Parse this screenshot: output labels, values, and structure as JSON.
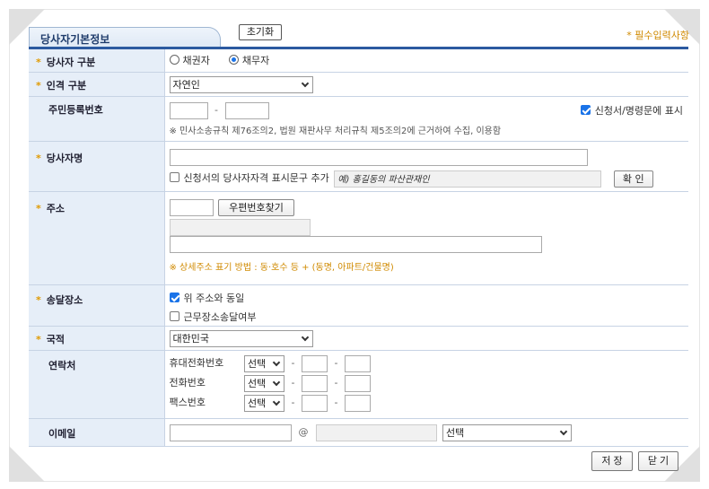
{
  "header": {
    "tab_title": "당사자기본정보",
    "reset_label": "초기화",
    "required_note": "* 필수입력사항"
  },
  "fields": {
    "party_type": {
      "label": "당사자 구분",
      "options": [
        "채권자",
        "채무자"
      ],
      "selected": "채무자"
    },
    "person_type": {
      "label": "인격 구분",
      "value": "자연인"
    },
    "resident_no": {
      "label": "주민등록번호",
      "dash": "-",
      "show_checkbox_label": "신청서/명령문에 표시",
      "show_checked": true,
      "notice": "※ 민사소송규칙 제76조의2, 법원 재판사무 처리규칙 제5조의2에 근거하여 수집, 이용함"
    },
    "party_name": {
      "label": "당사자명",
      "qualification_label": "신청서의 당사자자격 표시문구 추가",
      "qualification_checked": false,
      "qualification_placeholder": "예) 홍길동의 파산관재인",
      "confirm_label": "확 인"
    },
    "address": {
      "label": "주소",
      "zip_button": "우편번호찾기",
      "guide": "※ 상세주소 표기 방법 : 동·호수 등 + (동명, 아파트/건물명)"
    },
    "delivery": {
      "label": "송달장소",
      "same_label": "위 주소와 동일",
      "same_checked": true,
      "work_label": "근무장소송달여부",
      "work_checked": false
    },
    "nationality": {
      "label": "국적",
      "value": "대한민국"
    },
    "contact": {
      "label": "연락처",
      "rows": [
        {
          "label": "휴대전화번호",
          "select": "선택"
        },
        {
          "label": "전화번호",
          "select": "선택"
        },
        {
          "label": "팩스번호",
          "select": "선택"
        }
      ],
      "dash": "-"
    },
    "email": {
      "label": "이메일",
      "at": "@",
      "domain_select": "선택"
    }
  },
  "footer": {
    "save_label": "저 장",
    "close_label": "닫 기"
  },
  "colors": {
    "accent": "#2c5aa0",
    "label_bg": "#e6eef8",
    "required": "#e09a00"
  }
}
